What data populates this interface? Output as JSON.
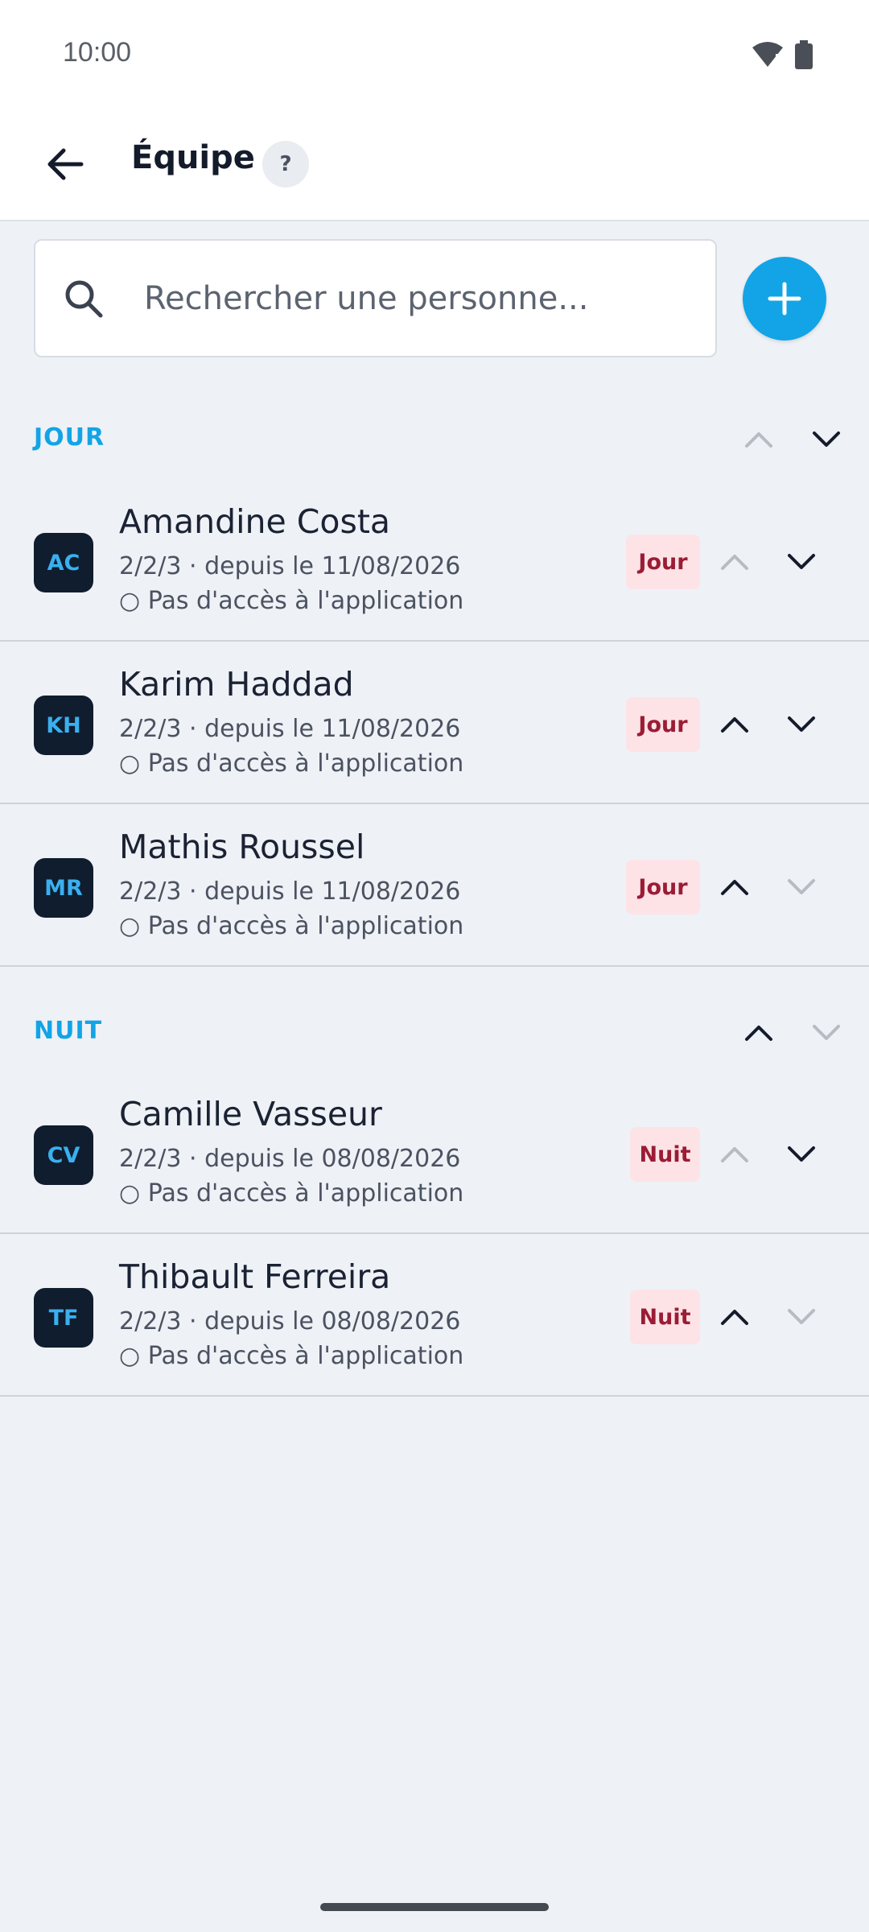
{
  "status_bar": {
    "time": "10:00"
  },
  "header": {
    "title": "Équipe",
    "help_label": "?"
  },
  "search": {
    "placeholder": "Rechercher une personne..."
  },
  "sections": [
    {
      "title": "JOUR",
      "members": [
        {
          "initials": "AC",
          "name": "Amandine Costa",
          "detail": "2/2/3 · depuis le 11/08/2026",
          "access": "○ Pas d'accès à l'application",
          "badge": "Jour"
        },
        {
          "initials": "KH",
          "name": "Karim Haddad",
          "detail": "2/2/3 · depuis le 11/08/2026",
          "access": "○ Pas d'accès à l'application",
          "badge": "Jour"
        },
        {
          "initials": "MR",
          "name": "Mathis Roussel",
          "detail": "2/2/3 · depuis le 11/08/2026",
          "access": "○ Pas d'accès à l'application",
          "badge": "Jour"
        }
      ]
    },
    {
      "title": "NUIT",
      "members": [
        {
          "initials": "CV",
          "name": "Camille Vasseur",
          "detail": "2/2/3 · depuis le 08/08/2026",
          "access": "○ Pas d'accès à l'application",
          "badge": "Nuit"
        },
        {
          "initials": "TF",
          "name": "Thibault Ferreira",
          "detail": "2/2/3 · depuis le 08/08/2026",
          "access": "○ Pas d'accès à l'application",
          "badge": "Nuit"
        }
      ]
    }
  ],
  "colors": {
    "accent": "#12a4e6",
    "badge_bg": "#fde3e6",
    "badge_text": "#9a1c35",
    "avatar_bg": "#0f1d2e"
  }
}
